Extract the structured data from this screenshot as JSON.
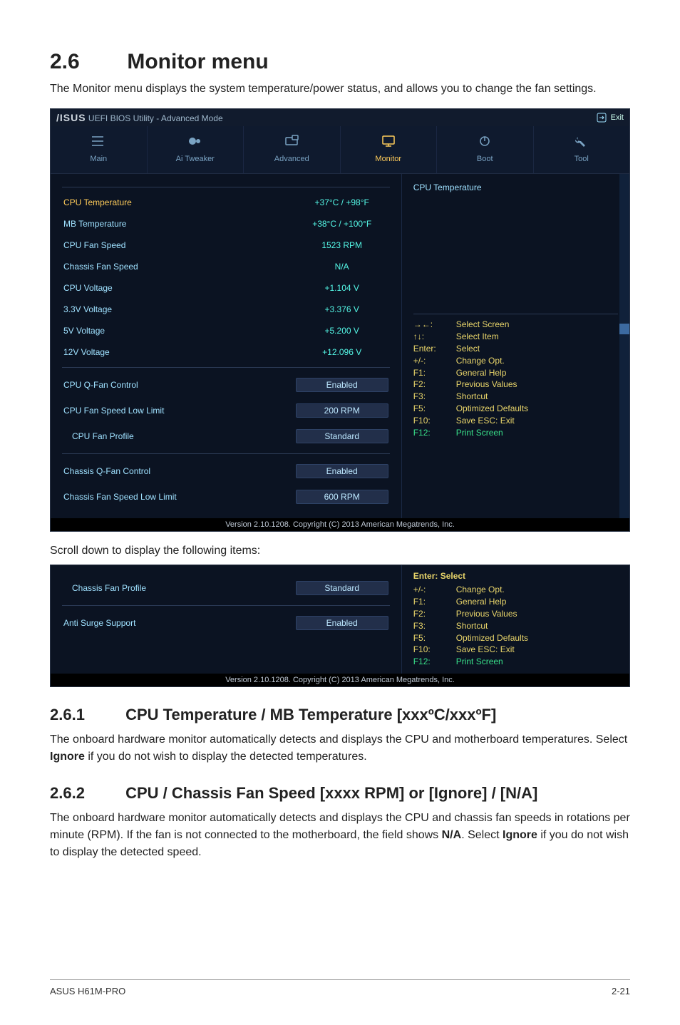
{
  "page": {
    "section_number": "2.6",
    "section_title": "Monitor menu",
    "intro": "The Monitor menu displays the system temperature/power status, and allows you to change the fan settings.",
    "between_caption": "Scroll down to display the following items:",
    "footer_left": "ASUS H61M-PRO",
    "footer_right": "2-21"
  },
  "bios": {
    "brand": "/ISUS",
    "title_rest": " UEFI BIOS Utility - Advanced Mode",
    "exit_label": "Exit",
    "tabs": {
      "main": "Main",
      "ai_tweaker": "Ai Tweaker",
      "advanced": "Advanced",
      "monitor": "Monitor",
      "boot": "Boot",
      "tool": "Tool"
    },
    "rows": [
      {
        "label": "CPU Temperature",
        "value": "+37°C / +98°F",
        "yellow": true
      },
      {
        "label": "MB Temperature",
        "value": "+38°C / +100°F"
      },
      {
        "label": "CPU Fan Speed",
        "value": "1523 RPM"
      },
      {
        "label": "Chassis Fan  Speed",
        "value": "N/A"
      },
      {
        "label": "CPU Voltage",
        "value": "+1.104 V"
      },
      {
        "label": "3.3V Voltage",
        "value": "+3.376 V"
      },
      {
        "label": "5V Voltage",
        "value": "+5.200 V"
      },
      {
        "label": "12V Voltage",
        "value": "+12.096 V"
      }
    ],
    "controls": [
      {
        "label": "CPU Q-Fan Control",
        "value": "Enabled"
      },
      {
        "label": "CPU Fan Speed Low Limit",
        "value": "200 RPM"
      },
      {
        "label": "CPU Fan Profile",
        "value": "Standard"
      }
    ],
    "controls2": [
      {
        "label": "Chassis Q-Fan Control",
        "value": "Enabled"
      },
      {
        "label": "Chassis Fan Speed Low Limit",
        "value": "600 RPM"
      }
    ],
    "right_title": "CPU Temperature",
    "help": [
      {
        "key": "→←:",
        "act": "Select Screen"
      },
      {
        "key": "↑↓:",
        "act": "Select Item"
      },
      {
        "key": "Enter:",
        "act": "Select"
      },
      {
        "key": "+/-:",
        "act": "Change Opt."
      },
      {
        "key": "F1:",
        "act": "General Help"
      },
      {
        "key": "F2:",
        "act": "Previous Values"
      },
      {
        "key": "F3:",
        "act": "Shortcut"
      },
      {
        "key": "F5:",
        "act": "Optimized Defaults"
      },
      {
        "key": "F10:",
        "act": "Save   ESC: Exit"
      },
      {
        "key": "F12:",
        "act": "Print Screen",
        "green": true
      }
    ],
    "copyright": "Version 2.10.1208. Copyright (C) 2013 American Megatrends, Inc."
  },
  "bios2": {
    "rows": [
      {
        "label": "Chassis Fan Profile",
        "value": "Standard"
      },
      {
        "label": "Anti Surge Support",
        "value": "Enabled"
      }
    ],
    "help_head": "Enter: Select",
    "help": [
      {
        "key": "+/-:",
        "act": "Change Opt."
      },
      {
        "key": "F1:",
        "act": "General Help"
      },
      {
        "key": "F2:",
        "act": "Previous Values"
      },
      {
        "key": "F3:",
        "act": "Shortcut"
      },
      {
        "key": "F5:",
        "act": "Optimized Defaults"
      },
      {
        "key": "F10:",
        "act": "Save   ESC: Exit"
      },
      {
        "key": "F12:",
        "act": "Print Screen",
        "green": true
      }
    ],
    "copyright": "Version 2.10.1208. Copyright (C) 2013 American Megatrends, Inc."
  },
  "sub1": {
    "num": "2.6.1",
    "title": "CPU Temperature / MB Temperature [xxxºC/xxxºF]",
    "para_a": "The onboard hardware monitor automatically detects and displays the CPU and motherboard temperatures. Select ",
    "para_b": "Ignore",
    "para_c": " if you do not wish to display the detected temperatures."
  },
  "sub2": {
    "num": "2.6.2",
    "title": "CPU / Chassis Fan Speed [xxxx RPM] or [Ignore] / [N/A]",
    "para_a": "The onboard hardware monitor automatically detects and displays the CPU and chassis fan speeds in rotations per minute (RPM). If the fan is not connected to the motherboard, the field shows ",
    "para_b": "N/A",
    "para_c": ". Select ",
    "para_d": "Ignore",
    "para_e": " if you do not wish to display the detected speed."
  }
}
